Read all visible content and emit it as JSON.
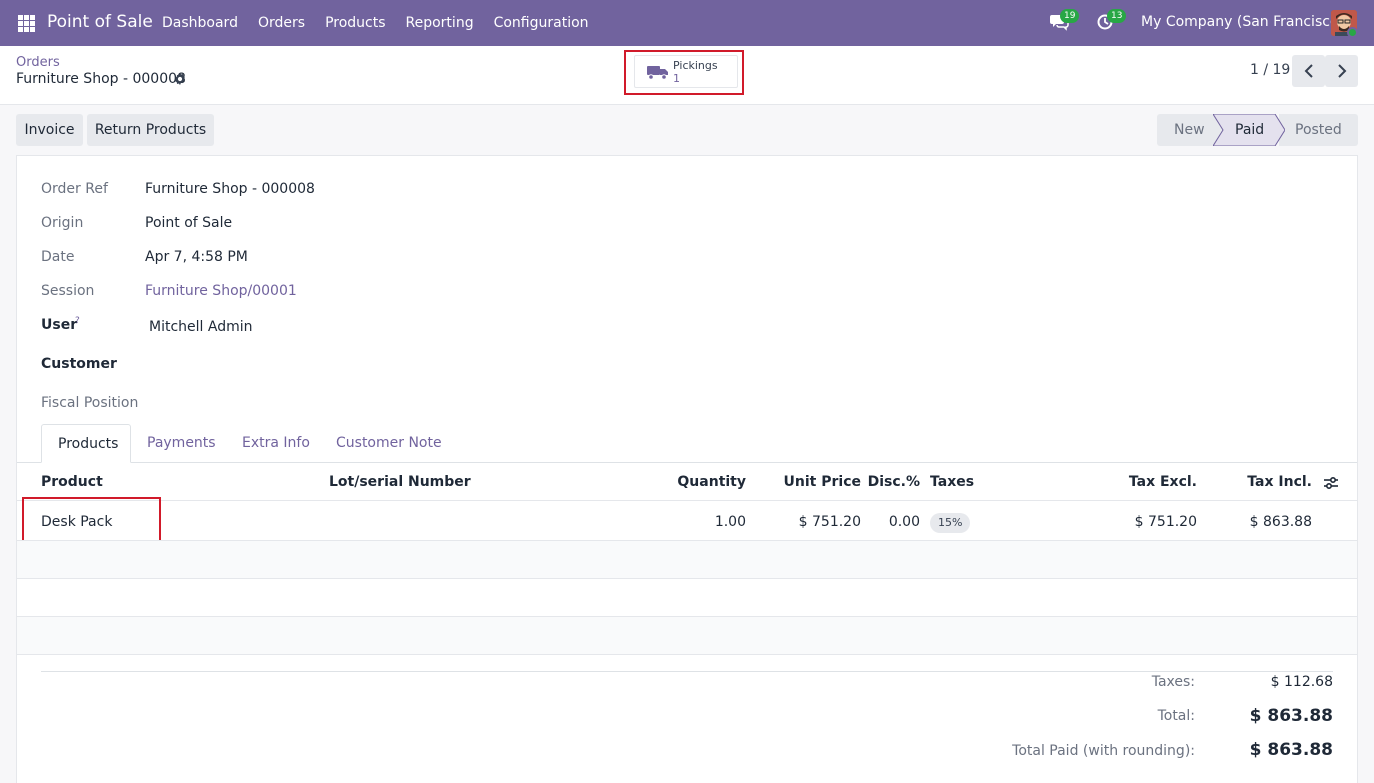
{
  "navbar": {
    "app_name": "Point of Sale",
    "menu": [
      "Dashboard",
      "Orders",
      "Products",
      "Reporting",
      "Configuration"
    ],
    "messages_count": "19",
    "activities_count": "13",
    "company": "My Company (San Francisco)"
  },
  "breadcrumb": {
    "parent": "Orders",
    "current": "Furniture Shop - 000008"
  },
  "smart_button": {
    "label": "Pickings",
    "value": "1"
  },
  "pager": {
    "value": "1 / 19"
  },
  "actions": {
    "invoice": "Invoice",
    "return_products": "Return Products"
  },
  "status": {
    "stages": [
      "New",
      "Paid",
      "Posted"
    ],
    "current": "Paid"
  },
  "form": {
    "order_ref_label": "Order Ref",
    "order_ref": "Furniture Shop - 000008",
    "origin_label": "Origin",
    "origin": "Point of Sale",
    "date_label": "Date",
    "date": "Apr 7, 4:58 PM",
    "session_label": "Session",
    "session": "Furniture Shop/00001",
    "user_label": "User",
    "user_help": "?",
    "user": "Mitchell Admin",
    "customer_label": "Customer",
    "fiscal_position_label": "Fiscal Position"
  },
  "tabs": [
    "Products",
    "Payments",
    "Extra Info",
    "Customer Note"
  ],
  "table": {
    "columns": [
      "Product",
      "Lot/serial Number",
      "Quantity",
      "Unit Price",
      "Disc.%",
      "Taxes",
      "Tax Excl.",
      "Tax Incl."
    ],
    "rows": [
      {
        "product": "Desk Pack",
        "lot": "",
        "quantity": "1.00",
        "unit_price": "$ 751.20",
        "discount": "0.00",
        "taxes": "15%",
        "tax_excl": "$ 751.20",
        "tax_incl": "$ 863.88"
      }
    ]
  },
  "totals": {
    "taxes_label": "Taxes:",
    "taxes": "$ 112.68",
    "total_label": "Total:",
    "total": "$ 863.88",
    "total_paid_label": "Total Paid (with rounding):",
    "total_paid": "$ 863.88"
  },
  "colors": {
    "brand": "#71639e",
    "highlight": "#d11a2a",
    "badge": "#28a745"
  }
}
